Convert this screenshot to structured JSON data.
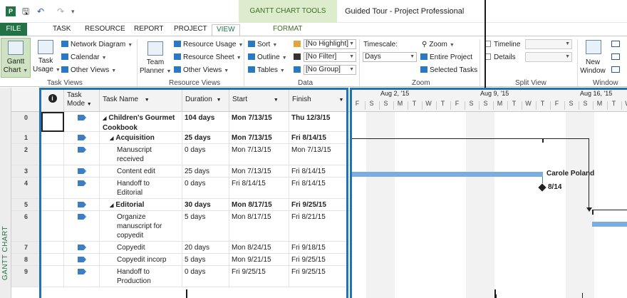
{
  "title_bar": {
    "contextual_tab": "GANTT CHART TOOLS",
    "document_title": "Guided Tour - Project Professional",
    "icons": [
      "project-app-icon",
      "save-icon",
      "undo-icon",
      "redo-icon",
      "customize-qat-icon"
    ]
  },
  "tabs": [
    "FILE",
    "TASK",
    "RESOURCE",
    "REPORT",
    "PROJECT",
    "VIEW",
    "FORMAT"
  ],
  "active_tab": "VIEW",
  "ribbon": {
    "task_views": {
      "gantt_chart": [
        "Gantt",
        "Chart"
      ],
      "task_usage": [
        "Task",
        "Usage"
      ],
      "network_diagram": "Network Diagram",
      "calendar": "Calendar",
      "other_views": "Other Views",
      "group_label": "Task Views"
    },
    "resource_views": {
      "team_planner": [
        "Team",
        "Planner"
      ],
      "resource_usage": "Resource Usage",
      "resource_sheet": "Resource Sheet",
      "other_views": "Other Views",
      "group_label": "Resource Views"
    },
    "data": {
      "sort": "Sort",
      "outline": "Outline",
      "tables": "Tables",
      "highlight": "[No Highlight]",
      "filter": "[No Filter]",
      "group": "[No Group]",
      "group_label": "Data"
    },
    "zoom": {
      "timescale_label": "Timescale:",
      "timescale_value": "Days",
      "zoom": "Zoom",
      "entire_project": "Entire Project",
      "selected_tasks": "Selected Tasks",
      "group_label": "Zoom"
    },
    "split_view": {
      "timeline": "Timeline",
      "details": "Details",
      "group_label": "Split View"
    },
    "window": {
      "new_window": [
        "New",
        "Window"
      ],
      "group_label": "Window"
    }
  },
  "view_label": "GANTT CHART",
  "table": {
    "headers": {
      "mode": [
        "Task",
        "Mode"
      ],
      "name": "Task Name",
      "duration": "Duration",
      "start": "Start",
      "finish": "Finish"
    },
    "rows": [
      {
        "id": "0",
        "name": [
          "Children's Gourmet",
          "Cookbook"
        ],
        "duration": "104 days",
        "start": "Mon 7/13/15",
        "finish": "Thu 12/3/15",
        "bold": true,
        "expander": "◢"
      },
      {
        "id": "1",
        "name": [
          "Acquisition"
        ],
        "duration": "25 days",
        "start": "Mon 7/13/15",
        "finish": "Fri 8/14/15",
        "bold": true,
        "expander": "◢"
      },
      {
        "id": "2",
        "name": [
          "Manuscript",
          "received"
        ],
        "duration": "0 days",
        "start": "Mon 7/13/15",
        "finish": "Mon 7/13/15",
        "bold": false,
        "expander": ""
      },
      {
        "id": "3",
        "name": [
          "Content edit"
        ],
        "duration": "25 days",
        "start": "Mon 7/13/15",
        "finish": "Fri 8/14/15",
        "bold": false,
        "expander": ""
      },
      {
        "id": "4",
        "name": [
          "Handoff to",
          "Editorial"
        ],
        "duration": "0 days",
        "start": "Fri 8/14/15",
        "finish": "Fri 8/14/15",
        "bold": false,
        "expander": ""
      },
      {
        "id": "5",
        "name": [
          "Editorial"
        ],
        "duration": "30 days",
        "start": "Mon 8/17/15",
        "finish": "Fri 9/25/15",
        "bold": true,
        "expander": "◢"
      },
      {
        "id": "6",
        "name": [
          "Organize",
          "manuscript for",
          "copyedit"
        ],
        "duration": "5 days",
        "start": "Mon 8/17/15",
        "finish": "Fri 8/21/15",
        "bold": false,
        "expander": ""
      },
      {
        "id": "7",
        "name": [
          "Copyedit"
        ],
        "duration": "20 days",
        "start": "Mon 8/24/15",
        "finish": "Fri 9/18/15",
        "bold": false,
        "expander": ""
      },
      {
        "id": "8",
        "name": [
          "Copyedit incorp"
        ],
        "duration": "5 days",
        "start": "Mon 9/21/15",
        "finish": "Fri 9/25/15",
        "bold": false,
        "expander": ""
      },
      {
        "id": "9",
        "name": [
          "Handoff to",
          "Production"
        ],
        "duration": "0 days",
        "start": "Fri 9/25/15",
        "finish": "Fri 9/25/15",
        "bold": false,
        "expander": ""
      }
    ]
  },
  "gantt": {
    "weeks": [
      "Aug 2, '15",
      "Aug 9, '15",
      "Aug 16, '15"
    ],
    "days": [
      "F",
      "S",
      "S",
      "M",
      "T",
      "W",
      "T",
      "F",
      "S",
      "S",
      "M",
      "T",
      "W",
      "T",
      "F",
      "S",
      "S",
      "M",
      "T",
      "W"
    ],
    "resource_label": "Carole Poland",
    "milestone_label": "8/14",
    "bar_color": "#7aaee0",
    "highlight_color": "#1e73b8"
  }
}
